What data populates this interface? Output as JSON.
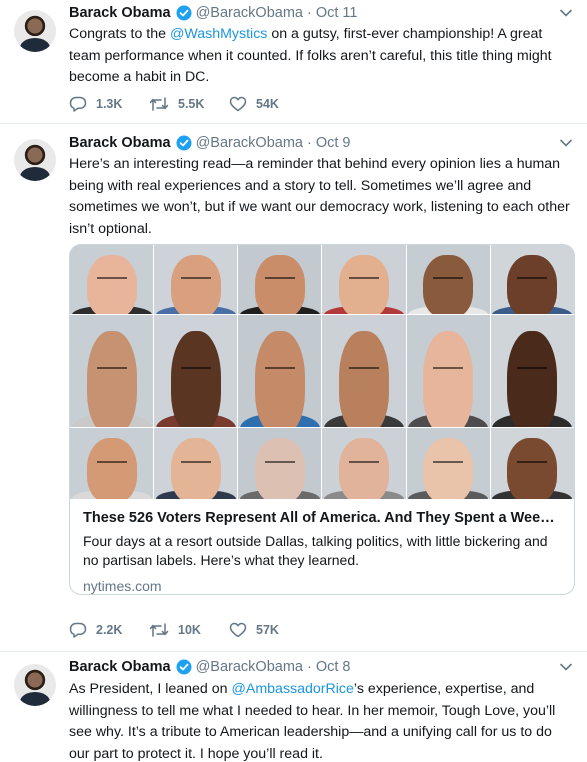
{
  "colors": {
    "link": "#1b95e0",
    "muted": "#657786",
    "text": "#14171a",
    "border": "#e6ecf0",
    "verified": "#1da1f2"
  },
  "tweets": [
    {
      "name": "Barack Obama",
      "handle": "@BarackObama",
      "sep": "·",
      "date": "Oct 11",
      "text_before": "Congrats to the ",
      "mention": "@WashMystics",
      "text_after": " on a gutsy, first-ever championship! A great team performance when it counted. If folks aren’t careful, this title thing might become a habit in DC.",
      "replies": "1.3K",
      "retweets": "5.5K",
      "likes": "54K"
    },
    {
      "name": "Barack Obama",
      "handle": "@BarackObama",
      "sep": "·",
      "date": "Oct 9",
      "text": "Here’s an interesting read—a reminder that behind every opinion lies a human being with real experiences and a story to tell. Sometimes we’ll agree and sometimes we won’t, but if we want our democracy work, listening to each other isn’t optional.",
      "card": {
        "title": "These 526 Voters Represent All of America. And They Spent a Weeke...",
        "description": "Four days at a resort outside Dallas, talking politics, with little bickering and no partisan labels. Here’s what they learned.",
        "domain": "nytimes.com"
      },
      "replies": "2.2K",
      "retweets": "10K",
      "likes": "57K"
    },
    {
      "name": "Barack Obama",
      "handle": "@BarackObama",
      "sep": "·",
      "date": "Oct 8",
      "text_before": "As President, I leaned on ",
      "mention": "@AmbassadorRice",
      "text_after": "’s experience, expertise, and willingness to tell me what I needed to hear. In her memoir, Tough Love, you’ll see why. It’s a tribute to American leadership—and a unifying call for us to do our part to protect it. I hope you’ll read it."
    }
  ]
}
